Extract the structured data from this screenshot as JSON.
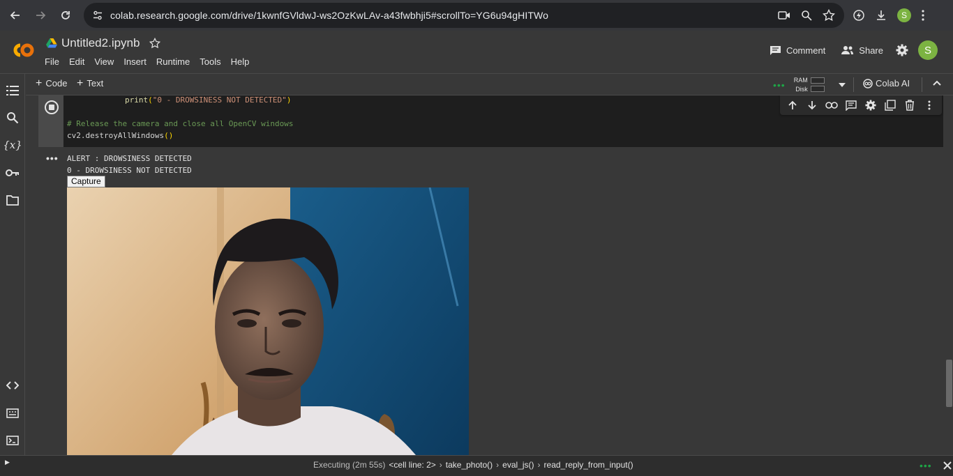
{
  "browser": {
    "url": "colab.research.google.com/drive/1kwnfGVldwJ-ws2OzKwLAv-a43fwbhji5#scrollTo=YG6u94gHITWo",
    "profile_initial": "S"
  },
  "header": {
    "logo_text": "CO",
    "notebook_title": "Untitled2.ipynb",
    "menu": [
      "File",
      "Edit",
      "View",
      "Insert",
      "Runtime",
      "Tools",
      "Help"
    ],
    "comment_label": "Comment",
    "share_label": "Share",
    "avatar_initial": "S"
  },
  "toolbar": {
    "code_label": "Code",
    "text_label": "Text",
    "ram_label": "RAM",
    "disk_label": "Disk",
    "colab_ai_label": "Colab AI"
  },
  "cell": {
    "line1_fn": "print",
    "line1_str": "\"0 - DROWSINESS NOT DETECTED\"",
    "comment": "# Release the camera and close all OpenCV windows",
    "line3_obj": "cv2.destroyAllWindows"
  },
  "output": {
    "line1": "ALERT : DROWSINESS DETECTED",
    "line2": "0 - DROWSINESS NOT DETECTED",
    "capture_label": "Capture"
  },
  "status": {
    "executing": "Executing (2m 55s)",
    "trace": [
      "<cell line: 2>",
      "take_photo()",
      "eval_js()",
      "read_reply_from_input()"
    ]
  },
  "colors": {
    "accent_green": "#1ea446",
    "colab_orange": "#f9ab00",
    "avatar_green": "#7cb342"
  }
}
